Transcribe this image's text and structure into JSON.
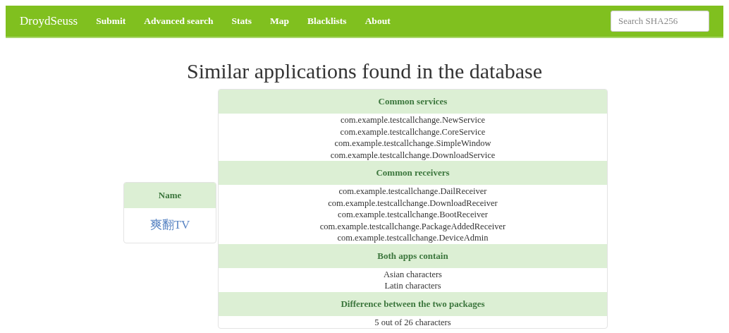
{
  "navbar": {
    "brand": "DroydSeuss",
    "links": [
      "Submit",
      "Advanced search",
      "Stats",
      "Map",
      "Blacklists",
      "About"
    ],
    "search": {
      "placeholder": "Search SHA256"
    }
  },
  "title": "Similar applications found in the database",
  "name_table": {
    "header": "Name",
    "value": "爽翻TV"
  },
  "sections": [
    {
      "header": "Common services",
      "items": [
        "com.example.testcallchange.NewService",
        "com.example.testcallchange.CoreService",
        "com.example.testcallchange.SimpleWindow",
        "com.example.testcallchange.DownloadService"
      ]
    },
    {
      "header": "Common receivers",
      "items": [
        "com.example.testcallchange.DailReceiver",
        "com.example.testcallchange.DownloadReceiver",
        "com.example.testcallchange.BootReceiver",
        "com.example.testcallchange.PackageAddedReceiver",
        "com.example.testcallchange.DeviceAdmin"
      ]
    },
    {
      "header": "Both apps contain",
      "items": [
        "Asian characters",
        "Latin characters"
      ]
    },
    {
      "header": "Difference between the two packages",
      "items": [
        "5 out of 26 characters"
      ]
    }
  ]
}
